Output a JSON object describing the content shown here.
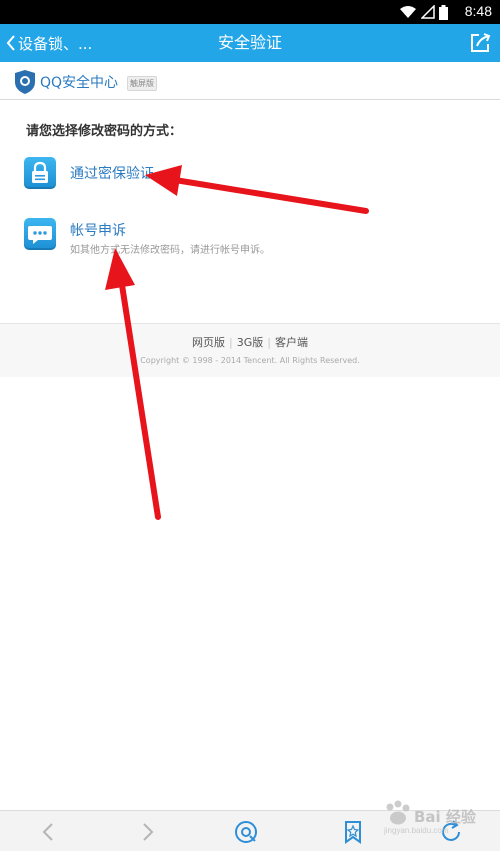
{
  "status_bar": {
    "time": "8:48"
  },
  "header": {
    "back_label": "设备锁、...",
    "title": "安全验证"
  },
  "brand": {
    "name": "QQ安全中心",
    "badge": "触屏版"
  },
  "content": {
    "prompt": "请您选择修改密码的方式：",
    "options": [
      {
        "label": "通过密保验证",
        "icon": "lock-icon"
      },
      {
        "label": "帐号申诉",
        "description": "如其他方式无法修改密码，请进行帐号申诉。",
        "icon": "chat-bubble-icon"
      }
    ]
  },
  "footer": {
    "links": [
      "网页版",
      "3G版",
      "客户端"
    ],
    "separator": "|",
    "copyright": "Copyright © 1998 - 2014 Tencent. All Rights Reserved."
  },
  "toolbar": {
    "icons": [
      "back-icon",
      "forward-icon",
      "home-icon",
      "bookmark-icon",
      "refresh-icon"
    ]
  },
  "watermark": {
    "text": "Bai 经验",
    "url": "jingyan.baidu.com"
  },
  "colors": {
    "header": "#23a6e8",
    "link": "#2a7bc1",
    "annotation": "#e8141b"
  }
}
